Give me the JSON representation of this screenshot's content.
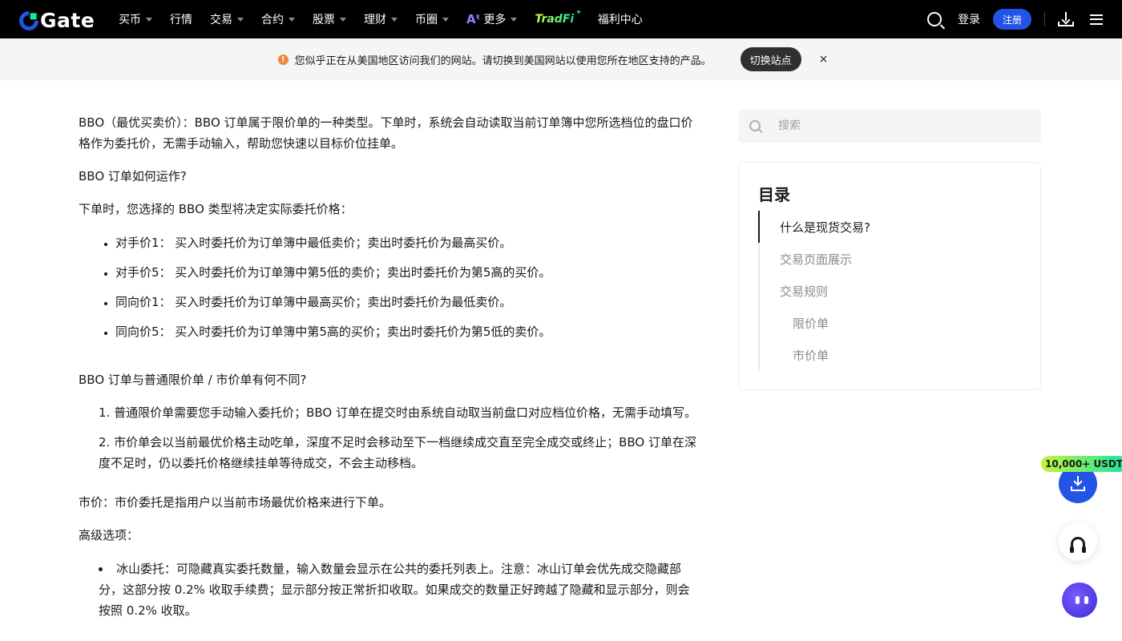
{
  "navbar": {
    "logo_text": "Gate",
    "items": [
      {
        "label": "买币",
        "has_caret": true
      },
      {
        "label": "行情",
        "has_caret": false
      },
      {
        "label": "交易",
        "has_caret": true
      },
      {
        "label": "合约",
        "has_caret": true
      },
      {
        "label": "股票",
        "has_caret": true
      },
      {
        "label": "理财",
        "has_caret": true
      },
      {
        "label": "币圈",
        "has_caret": true
      },
      {
        "label": "更多",
        "has_caret": true
      }
    ],
    "ai_icon": "Aᵗ",
    "tradfi_label": "TradFi",
    "welfare_label": "福利中心",
    "login_label": "登录",
    "register_label": "注册"
  },
  "notice": {
    "icon": "!",
    "text": "您似乎正在从美国地区访问我们的网站。请切换到美国网站以使用您所在地区支持的产品。",
    "switch_label": "切换站点",
    "close_label": "×"
  },
  "article": {
    "bbo_def": "BBO（最优买卖价）：BBO 订单属于限价单的一种类型。下单时，系统会自动读取当前订单簿中您所选档位的盘口价格作为委托价，无需手动输入，帮助您快速以目标价位挂单。",
    "bbo_how_q": "BBO 订单如何运作?",
    "bbo_how_intro": "下单时，您选择的 BBO 类型将决定实际委托价格：",
    "bbo_types": [
      "对手价1： 买入时委托价为订单簿中最低卖价；卖出时委托价为最高买价。",
      "对手价5： 买入时委托价为订单簿中第5低的卖价；卖出时委托价为第5高的买价。",
      "同向价1： 买入时委托价为订单簿中最高买价；卖出时委托价为最低卖价。",
      "同向价5： 买入时委托价为订单簿中第5高的买价；卖出时委托价为第5低的卖价。"
    ],
    "diff_q": "BBO 订单与普通限价单 / 市价单有何不同?",
    "diff_items": [
      "1. 普通限价单需要您手动输入委托价；BBO 订单在提交时由系统自动取当前盘口对应档位价格，无需手动填写。",
      "2. 市价单会以当前最优价格主动吃单，深度不足时会移动至下一档继续成交直至完全成交或终止；BBO 订单在深度不足时，仍以委托价格继续挂单等待成交，不会主动移档。"
    ],
    "market_def": "市价：市价委托是指用户以当前市场最优价格来进行下单。",
    "advanced_label": "高级选项：",
    "iceberg": "冰山委托：可隐藏真实委托数量，输入数量会显示在公共的委托列表上。注意：冰山订单会优先成交隐藏部分，这部分按 0.2% 收取手续费；显示部分按正常折扣收取。如果成交的数量正好跨越了隐藏和显示部分，则会按照 0.2% 收取。"
  },
  "sidebar": {
    "search_placeholder": "搜索",
    "toc_title": "目录",
    "toc_items": [
      {
        "label": "什么是现货交易?",
        "active": true,
        "level": 1
      },
      {
        "label": "交易页面展示",
        "active": false,
        "level": 1
      },
      {
        "label": "交易规则",
        "active": false,
        "level": 1
      },
      {
        "label": "限价单",
        "active": false,
        "level": 2
      },
      {
        "label": "市价单",
        "active": false,
        "level": 2
      }
    ]
  },
  "floating": {
    "promo_badge": "10,000+ USDT",
    "download_icon": "download-icon",
    "support_icon": "headset-icon",
    "bot_icon": "chatbot-icon"
  },
  "colors": {
    "brand_blue": "#2354e6",
    "brand_green": "#17e5a2",
    "navbar_bg": "#000000",
    "warning": "#f0883e"
  }
}
